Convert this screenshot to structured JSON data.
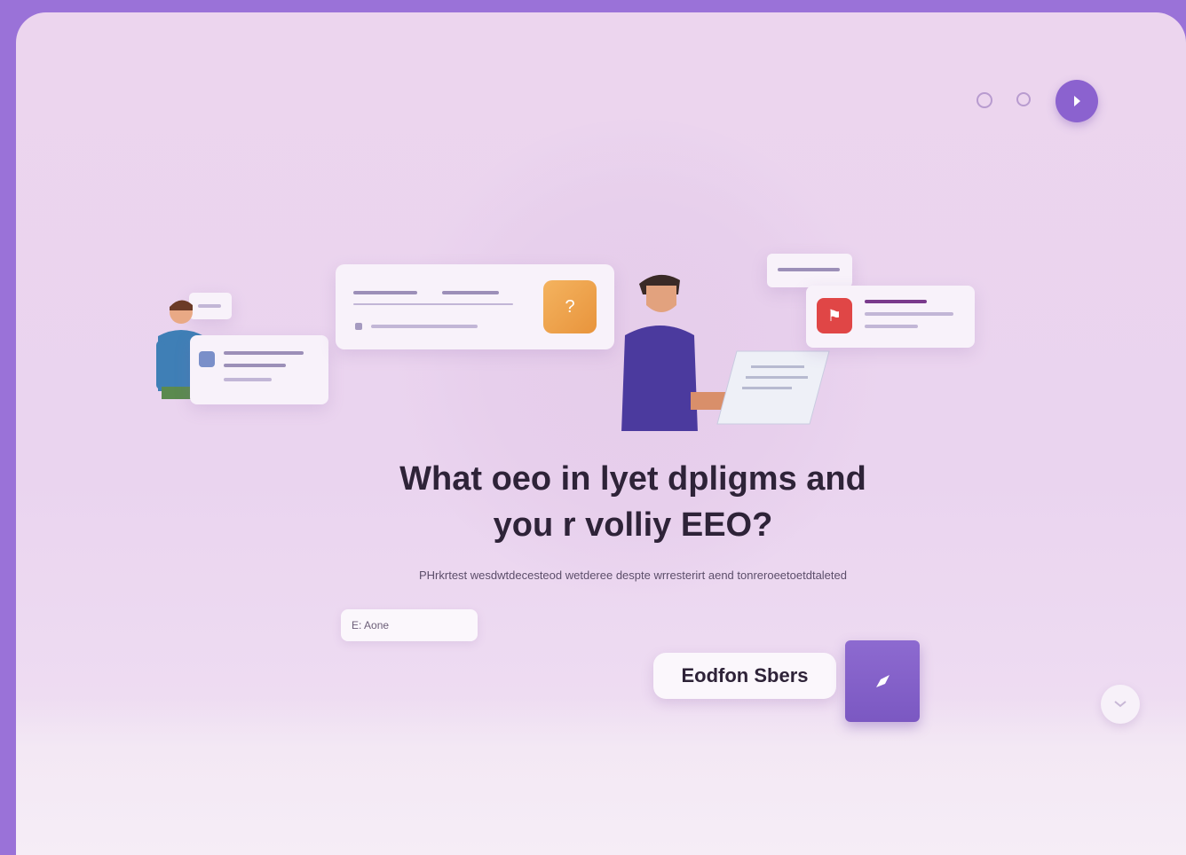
{
  "header": {
    "icons": [
      "circle-icon",
      "circle-icon",
      "profile-icon"
    ]
  },
  "hero": {
    "title_line1": "What oeo in lyet dpligms and",
    "title_line2": "you r volliy EEO?",
    "subtitle": "PHrkrtest wesdwtdecesteod wetderee despte wrresterirt aend tonreroeetoetdtaleted",
    "mini_input_value": "E: Aone",
    "primary_button": "Eodfon Sbers",
    "send_icon": "rocket-icon",
    "chat_icon": "chat-icon"
  },
  "colors": {
    "frame": "#9a72d8",
    "panel": "#ecd5ee",
    "accent": "#8b62cf",
    "title": "#2e2338"
  }
}
